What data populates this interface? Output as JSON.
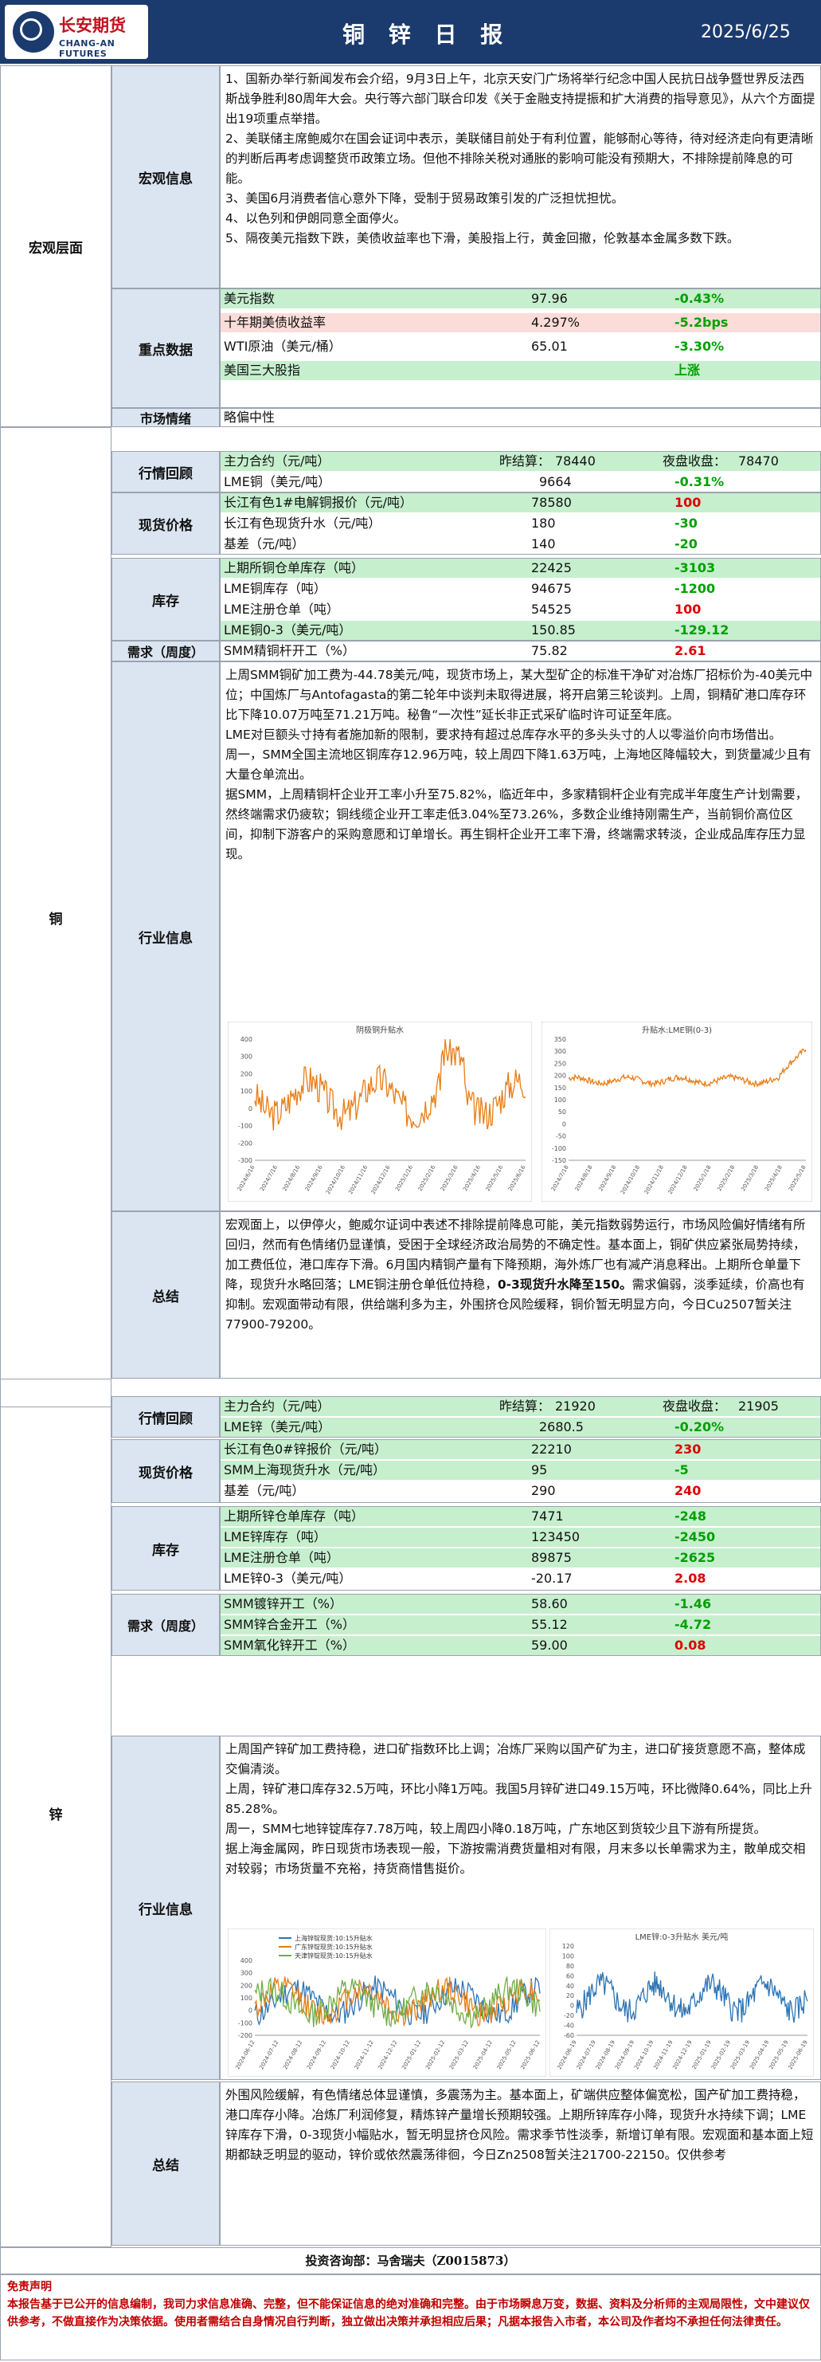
{
  "header": {
    "logo_cn": "长安期货",
    "logo_en": "CHANG-AN FUTURES",
    "title": "铜 锌 日 报",
    "date": "2025/6/25"
  },
  "macro": {
    "section": "宏观层面",
    "info_label": "宏观信息",
    "paragraphs": [
      "1、国新办举行新闻发布会介绍，9月3日上午，北京天安门广场将举行纪念中国人民抗日战争暨世界反法西斯战争胜利80周年大会。央行等六部门联合印发《关于金融支持提振和扩大消费的指导意见》，从六个方面提出19项重点举措。",
      "2、美联储主席鲍威尔在国会证词中表示，美联储目前处于有利位置，能够耐心等待，待对经济走向有更清晰的判断后再考虑调整货币政策立场。但他不排除关税对通胀的影响可能没有预期大，不排除提前降息的可能。",
      "3、美国6月消费者信心意外下降，受制于贸易政策引发的广泛担忧担忧。",
      "4、以色列和伊朗同意全面停火。",
      "5、隔夜美元指数下跌，美债收益率也下滑，美股指上行，黄金回撤，伦敦基本金属多数下跌。"
    ],
    "key_label": "重点数据",
    "key_rows": [
      {
        "name": "美元指数",
        "value": "97.96",
        "change": "-0.43%",
        "color": "green"
      },
      {
        "name": "十年期美债收益率",
        "value": "4.297%",
        "change": "-5.2bps",
        "color": "green"
      },
      {
        "name": "WTI原油（美元/桶）",
        "value": "65.01",
        "change": "-3.30%",
        "color": "green"
      },
      {
        "name": "美国三大股指",
        "value": "",
        "change": "上涨",
        "color": "green"
      }
    ],
    "sentiment_label": "市场情绪",
    "sentiment": "略偏中性"
  },
  "copper": {
    "section": "铜",
    "review_label": "行情回顾",
    "review": {
      "contract": "主力合约（元/吨）",
      "close_label": "昨结算：",
      "close": "78440",
      "night_label": "夜盘收盘：",
      "night": "78470",
      "lme_name": "LME铜（美元/吨）",
      "lme_value": "9664",
      "lme_change": "-0.31%"
    },
    "spot_label": "现货价格",
    "spot_rows": [
      {
        "name": "长江有色1#电解铜报价（元/吨）",
        "value": "78580",
        "change": "100",
        "color": "red"
      },
      {
        "name": "长江有色现货升水（元/吨）",
        "value": "180",
        "change": "-30",
        "color": "green"
      },
      {
        "name": "基差（元/吨）",
        "value": "140",
        "change": "-20",
        "color": "green"
      }
    ],
    "stock_label": "库存",
    "stock_rows": [
      {
        "name": "上期所铜仓单库存（吨）",
        "value": "22425",
        "change": "-3103",
        "color": "green"
      },
      {
        "name": "LME铜库存（吨）",
        "value": "94675",
        "change": "-1200",
        "color": "green"
      },
      {
        "name": "LME注册仓单（吨）",
        "value": "54525",
        "change": "100",
        "color": "red"
      },
      {
        "name": "LME铜0-3（美元/吨）",
        "value": "150.85",
        "change": "-129.12",
        "color": "green"
      }
    ],
    "demand_label": "需求（周度）",
    "demand_rows": [
      {
        "name": "SMM精铜杆开工（%）",
        "value": "75.82",
        "change": "2.61",
        "color": "red"
      }
    ],
    "industry_label": "行业信息",
    "industry_paragraphs": [
      "上周SMM铜矿加工费为-44.78美元/吨，现货市场上，某大型矿企的标准干净矿对冶炼厂招标价为-40美元中位；中国炼厂与Antofagasta的第二轮年中谈判未取得进展，将开启第三轮谈判。上周，铜精矿港口库存环比下降10.07万吨至71.21万吨。秘鲁“一次性”延长非正式采矿临时许可证至年底。",
      "LME对巨额头寸持有者施加新的限制，要求持有超过总库存水平的多头头寸的人以零溢价向市场借出。",
      "周一，SMM全国主流地区铜库存12.96万吨，较上周四下降1.63万吨，上海地区降幅较大，到货量减少且有大量仓单流出。",
      "据SMM，上周精铜杆企业开工率小升至75.82%，临近年中，多家精铜杆企业有完成半年度生产计划需要，然终端需求仍疲软；铜线缆企业开工率走低3.04%至73.26%，多数企业维持刚需生产，当前铜价高位区间，抑制下游客户的采购意愿和订单增长。再生铜杆企业开工率下滑，终端需求转淡，企业成品库存压力显现。"
    ],
    "chart1": {
      "title": "阴极铜升贴水",
      "x_ticks": [
        "2024/6/16",
        "2024/7/16",
        "2024/8/16",
        "2024/9/16",
        "2024/10/16",
        "2024/11/16",
        "2024/12/16",
        "2025/1/16",
        "2025/2/16",
        "2025/3/16",
        "2025/4/16",
        "2025/5/16",
        "2025/6/16"
      ],
      "y_ticks": [
        "400",
        "300",
        "200",
        "100",
        "0",
        "-100",
        "-200",
        "-300"
      ],
      "color": "#e87d16"
    },
    "chart2": {
      "title": "升贴水:LME铜(0-3)",
      "x_ticks": [
        "2024/7/18",
        "2024/8/18",
        "2024/9/18",
        "2024/10/18",
        "2024/11/18",
        "2024/12/18",
        "2025/1/18",
        "2025/2/18",
        "2025/3/18",
        "2025/4/18",
        "2025/5/18"
      ],
      "y_ticks": [
        "350",
        "300",
        "250",
        "200",
        "150",
        "100",
        "50",
        "0",
        "-50",
        "-100",
        "-150"
      ],
      "color": "#e87d16"
    },
    "summary_label": "总结",
    "summary_text": "宏观面上，以伊停火，鲍威尔证词中表述不排除提前降息可能，美元指数弱势运行，市场风险偏好情绪有所回归，然而有色情绪仍显谨慎，受困于全球经济政治局势的不确定性。基本面上，铜矿供应紧张局势持续，加工费低位，港口库存下滑。6月国内精铜产量有下降预期，海外炼厂也有减产消息释出。上期所仓单量下降，现货升水略回落；LME铜注册仓单低位持稳，",
    "summary_bold": "0-3现货升水降至150。",
    "summary_tail": "需求偏弱，淡季延续，价高也有抑制。宏观面带动有限，供给端利多为主，外围挤仓风险缓释，铜价暂无明显方向，今日Cu2507暂关注77900-79200。"
  },
  "zinc": {
    "section": "锌",
    "review_label": "行情回顾",
    "review": {
      "contract": "主力合约（元/吨）",
      "close_label": "昨结算：",
      "close": "21920",
      "night_label": "夜盘收盘：",
      "night": "21905",
      "lme_name": "LME锌（美元/吨）",
      "lme_value": "2680.5",
      "lme_change": "-0.20%"
    },
    "spot_label": "现货价格",
    "spot_rows": [
      {
        "name": "长江有色0#锌报价（元/吨）",
        "value": "22210",
        "change": "230",
        "color": "red"
      },
      {
        "name": "SMM上海现货升水（元/吨）",
        "value": "95",
        "change": "-5",
        "color": "green"
      },
      {
        "name": "基差（元/吨）",
        "value": "290",
        "change": "240",
        "color": "red"
      }
    ],
    "stock_label": "库存",
    "stock_rows": [
      {
        "name": "上期所锌仓单库存（吨）",
        "value": "7471",
        "change": "-248",
        "color": "green"
      },
      {
        "name": "LME锌库存（吨）",
        "value": "123450",
        "change": "-2450",
        "color": "green"
      },
      {
        "name": "LME注册仓单（吨）",
        "value": "89875",
        "change": "-2625",
        "color": "green"
      },
      {
        "name": "LME锌0-3（美元/吨）",
        "value": "-20.17",
        "change": "2.08",
        "color": "red"
      }
    ],
    "demand_label": "需求（周度）",
    "demand_rows": [
      {
        "name": "SMM镀锌开工（%）",
        "value": "58.60",
        "change": "-1.46",
        "color": "green"
      },
      {
        "name": "SMM锌合金开工（%）",
        "value": "55.12",
        "change": "-4.72",
        "color": "green"
      },
      {
        "name": "SMM氧化锌开工（%）",
        "value": "59.00",
        "change": "0.08",
        "color": "red"
      }
    ],
    "industry_label": "行业信息",
    "industry_paragraphs": [
      "上周国产锌矿加工费持稳，进口矿指数环比上调；冶炼厂采购以国产矿为主，进口矿接货意愿不高，整体成交偏清淡。",
      "上周，锌矿港口库存32.5万吨，环比小降1万吨。我国5月锌矿进口49.15万吨，环比微降0.64%，同比上升85.28%。",
      "周一，SMM七地锌锭库存7.78万吨，较上周四小降0.18万吨，广东地区到货较少且下游有所提货。",
      "据上海金属网，昨日现货市场表现一般，下游按需消费货量相对有限，月末多以长单需求为主，散单成交相对较弱；市场货量不充裕，持货商惜售挺价。"
    ],
    "chart3": {
      "legend": [
        "上海锌锭现货:10:15升贴水",
        "广东锌锭现货:10:15升贴水",
        "天津锌锭现货:10:15升贴水"
      ],
      "x_ticks": [
        "2024-06-12",
        "2024-07-12",
        "2024-08-12",
        "2024-09-12",
        "2024-10-12",
        "2024-11-12",
        "2024-12-12",
        "2025-01-12",
        "2025-02-12",
        "2025-03-12",
        "2025-04-12",
        "2025-05-12",
        "2025-06-12"
      ],
      "y_ticks": [
        "400",
        "300",
        "200",
        "100",
        "0",
        "-100",
        "-200"
      ],
      "colors": [
        "#2e75b6",
        "#e87d16",
        "#70ad47"
      ]
    },
    "chart4": {
      "title": "LME锌:0-3升贴水 美元/吨",
      "x_ticks": [
        "2024-06-19",
        "2024-07-19",
        "2024-08-19",
        "2024-09-19",
        "2024-10-19",
        "2024-11-19",
        "2024-12-19",
        "2025-01-19",
        "2025-02-19",
        "2025-03-19",
        "2025-04-19",
        "2025-05-19",
        "2025-06-19"
      ],
      "y_ticks": [
        "120",
        "100",
        "80",
        "60",
        "40",
        "20",
        "0",
        "-20",
        "-40",
        "-60"
      ],
      "color": "#2e75b6"
    },
    "summary_label": "总结",
    "summary_text": "外围风险缓解，有色情绪总体显谨慎，多震荡为主。基本面上，矿端供应整体偏宽松，国产矿加工费持稳，港口库存小降。冶炼厂利润修复，精炼锌产量增长预期较强。上期所锌库存小降，现货升水持续下调；LME锌库存下滑，0-3现货小幅贴水，暂无明显挤仓风险。需求季节性淡季，新增订单有限。宏观面和基本面上短期都缺乏明显的驱动，锌价或依然震荡徘徊，今日Zn2508暂关注21700-22150。仅供参考"
  },
  "footer": {
    "analyst": "投资咨询部：马舍瑞夫（Z0015873）",
    "disclaimer_title": "免责声明",
    "disclaimer": "本报告基于已公开的信息编制，我司力求信息准确、完整，但不能保证信息的绝对准确和完整。由于市场瞬息万变，数据、资料及分析师的主观局限性，文中建议仅供参考，不做直接作为决策依据。使用者需结合自身情况自行判断，独立做出决策并承担相应后果；凡据本报告入市者，本公司及作者均不承担任何法律责任。"
  }
}
